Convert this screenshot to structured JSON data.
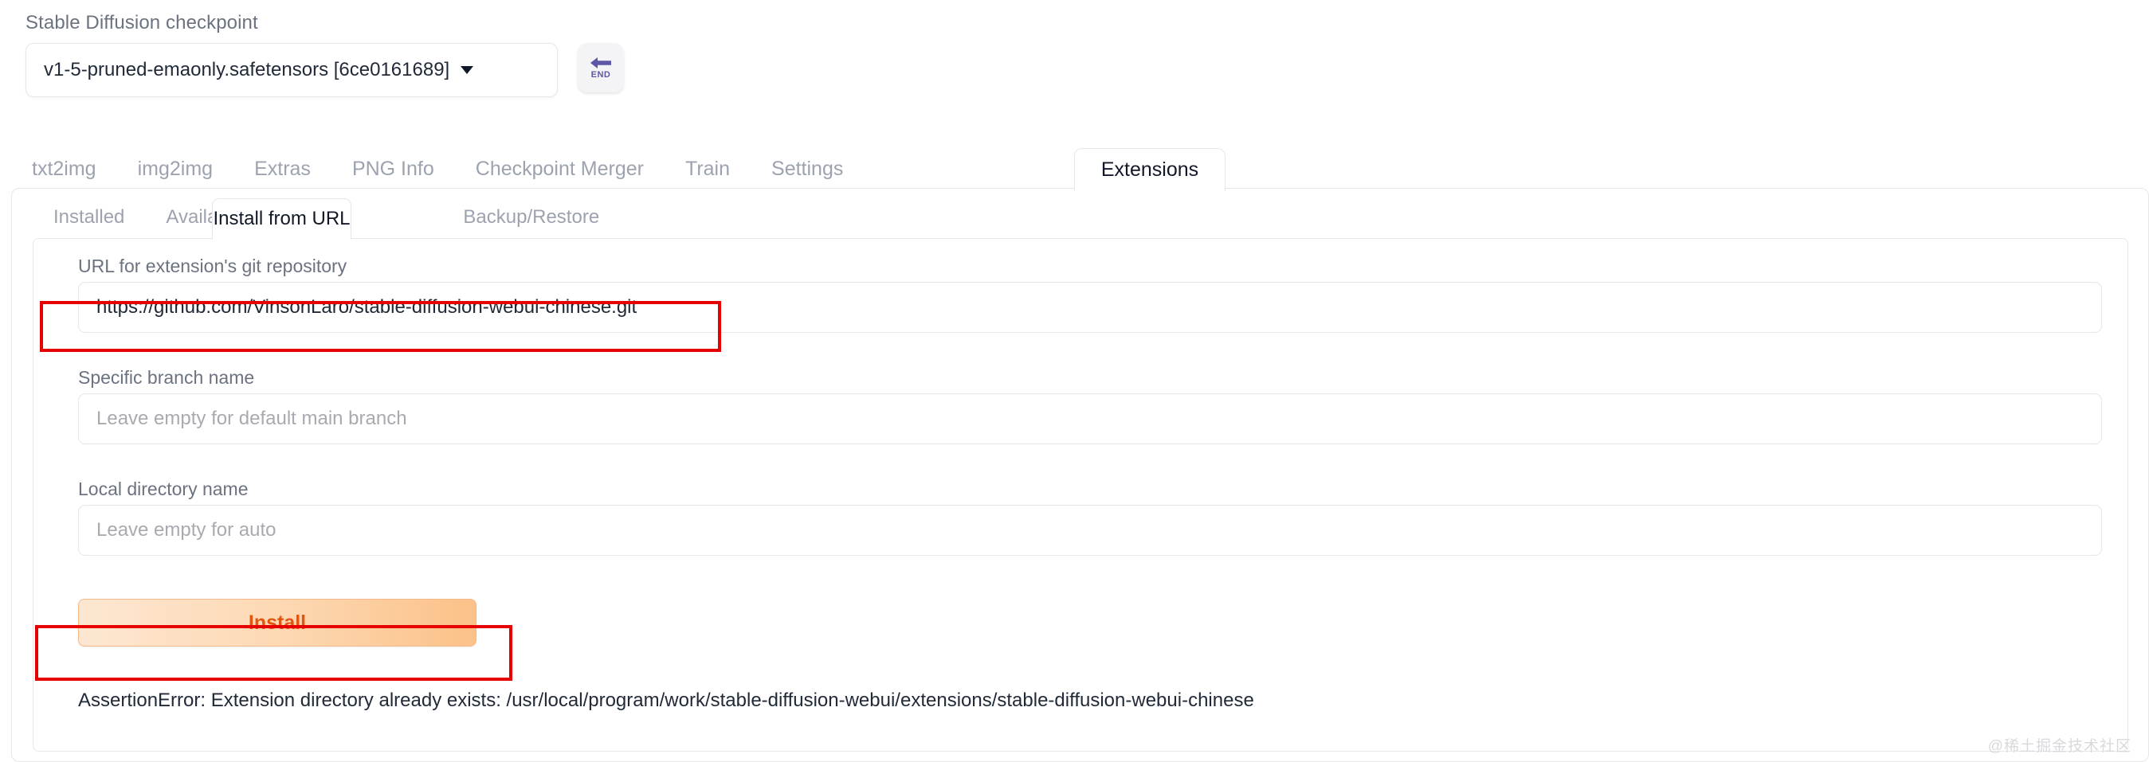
{
  "checkpoint": {
    "label": "Stable Diffusion checkpoint",
    "value": "v1-5-pruned-emaonly.safetensors [6ce0161689]",
    "dropdown_icon": "chevron-down-icon",
    "end_key": {
      "icon": "arrow-left-icon",
      "text": "END"
    }
  },
  "main_tabs": [
    {
      "label": "txt2img",
      "active": false
    },
    {
      "label": "img2img",
      "active": false
    },
    {
      "label": "Extras",
      "active": false
    },
    {
      "label": "PNG Info",
      "active": false
    },
    {
      "label": "Checkpoint Merger",
      "active": false
    },
    {
      "label": "Train",
      "active": false
    },
    {
      "label": "Settings",
      "active": false
    },
    {
      "label": "Extensions",
      "active": true
    }
  ],
  "sub_tabs": [
    {
      "label": "Installed",
      "active": false
    },
    {
      "label": "Available",
      "active": false
    },
    {
      "label": "Install from URL",
      "active": true
    },
    {
      "label": "Backup/Restore",
      "active": false
    }
  ],
  "form": {
    "url": {
      "label": "URL for extension's git repository",
      "value": "https://github.com/VinsonLaro/stable-diffusion-webui-chinese.git",
      "placeholder": ""
    },
    "branch": {
      "label": "Specific branch name",
      "value": "",
      "placeholder": "Leave empty for default main branch"
    },
    "directory": {
      "label": "Local directory name",
      "value": "",
      "placeholder": "Leave empty for auto"
    },
    "install_button": "Install"
  },
  "status": {
    "error": "AssertionError: Extension directory already exists: /usr/local/program/work/stable-diffusion-webui/extensions/stable-diffusion-webui-chinese"
  },
  "watermark": "@稀土掘金技术社区",
  "colors": {
    "annotation": "#e60000",
    "install_text": "#e2560f",
    "end_key_purple": "#5b56a6",
    "muted_text": "#9ca3af"
  }
}
